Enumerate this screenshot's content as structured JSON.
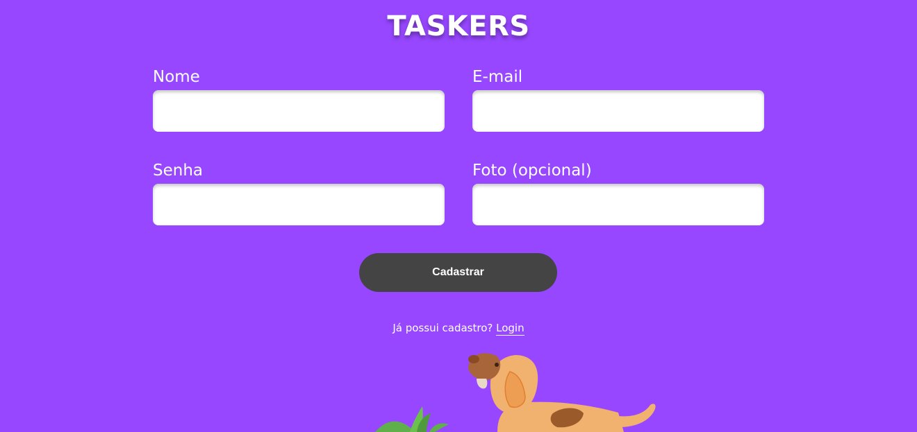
{
  "app": {
    "title": "TASKERS"
  },
  "form": {
    "fields": [
      {
        "label": "Nome",
        "value": "",
        "placeholder": ""
      },
      {
        "label": "E-mail",
        "value": "",
        "placeholder": ""
      },
      {
        "label": "Senha",
        "value": "",
        "placeholder": ""
      },
      {
        "label": "Foto (opcional)",
        "value": "",
        "placeholder": ""
      }
    ],
    "submit_label": "Cadastrar"
  },
  "footer": {
    "prompt": "Já possui cadastro?",
    "login_label": "Login"
  },
  "colors": {
    "background": "#9747ff",
    "button": "#444444",
    "input": "#ffffff",
    "text": "#ffffff"
  },
  "illustration": {
    "icon": "dog-with-plant-illustration"
  }
}
